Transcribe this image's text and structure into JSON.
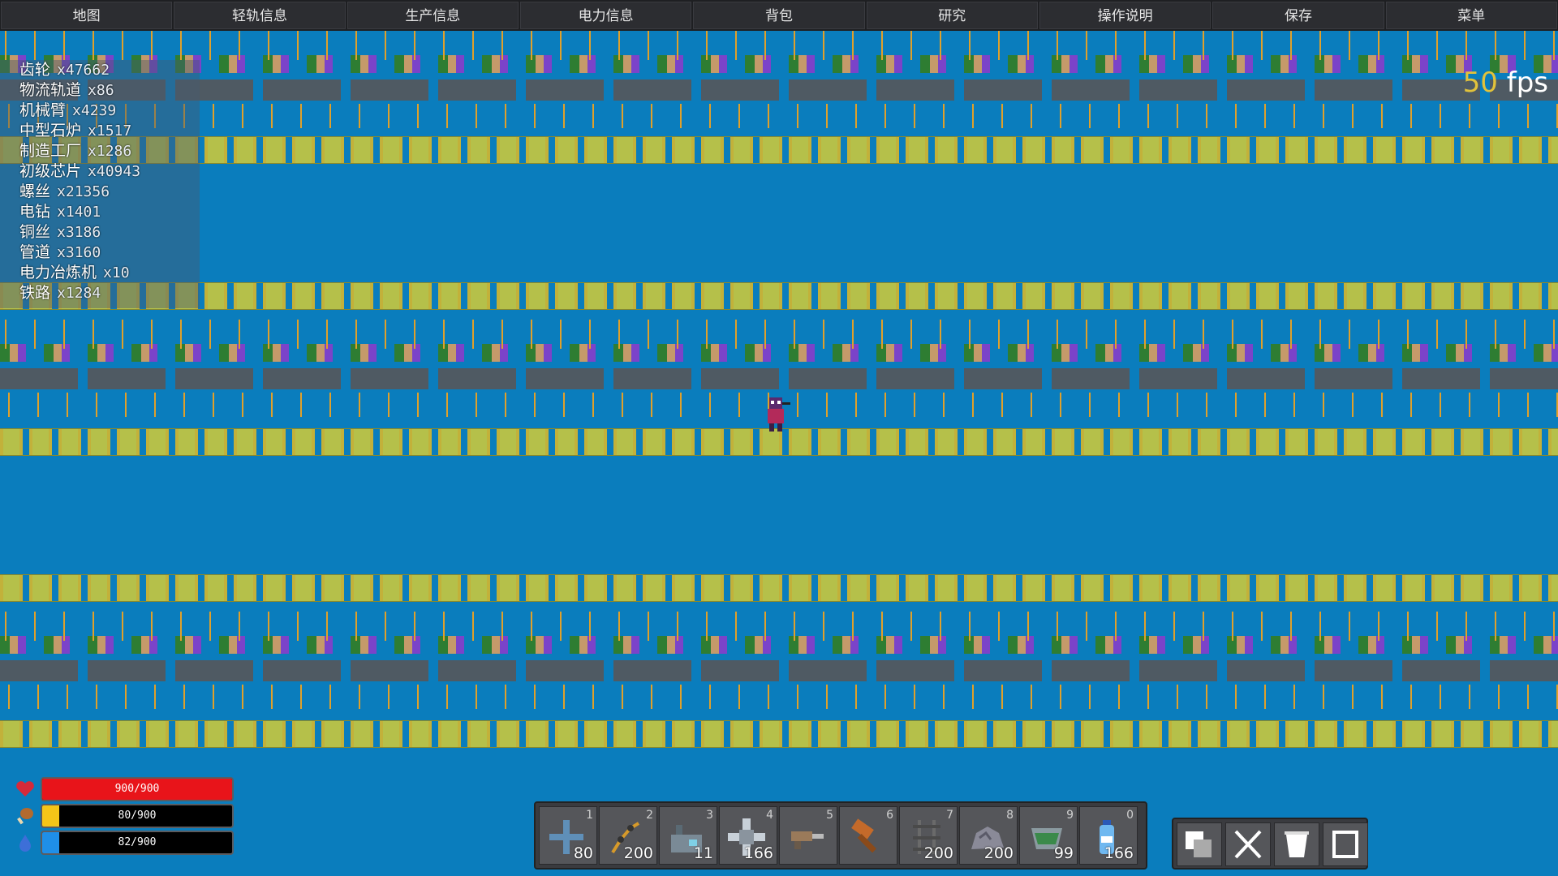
{
  "menu": {
    "items": [
      "地图",
      "轻轨信息",
      "生产信息",
      "电力信息",
      "背包",
      "研究",
      "操作说明",
      "保存",
      "菜单"
    ]
  },
  "inventory": {
    "items": [
      {
        "name": "齿轮",
        "count": "x47662"
      },
      {
        "name": "物流轨道",
        "count": "x86"
      },
      {
        "name": "机械臂",
        "count": "x4239"
      },
      {
        "name": "中型石炉",
        "count": "x1517"
      },
      {
        "name": "制造工厂",
        "count": "x1286"
      },
      {
        "name": "初级芯片",
        "count": "x40943"
      },
      {
        "name": "螺丝",
        "count": "x21356"
      },
      {
        "name": "电钻",
        "count": "x1401"
      },
      {
        "name": "铜丝",
        "count": "x3186"
      },
      {
        "name": "管道",
        "count": "x3160"
      },
      {
        "name": "电力冶炼机",
        "count": "x10"
      },
      {
        "name": "铁路",
        "count": "x1284"
      }
    ]
  },
  "fps": {
    "value": "50",
    "unit": "fps"
  },
  "stats": {
    "health": {
      "text": "900/900",
      "fraction": 1.0,
      "color": "#e8141a",
      "icon": "heart-icon"
    },
    "hunger": {
      "text": "80/900",
      "fraction": 0.089,
      "color": "#f5c518",
      "icon": "drumstick-icon"
    },
    "water": {
      "text": "82/900",
      "fraction": 0.091,
      "color": "#1f8fe8",
      "icon": "water-drop-icon"
    }
  },
  "hotbar": {
    "slots": [
      {
        "key": "1",
        "count": "80",
        "icon": "cross-tile-icon"
      },
      {
        "key": "2",
        "count": "200",
        "icon": "robot-arm-icon"
      },
      {
        "key": "3",
        "count": "11",
        "icon": "factory-machine-icon"
      },
      {
        "key": "4",
        "count": "166",
        "icon": "pipe-junction-icon"
      },
      {
        "key": "5",
        "count": "",
        "icon": "drill-icon"
      },
      {
        "key": "6",
        "count": "",
        "icon": "hammer-icon"
      },
      {
        "key": "7",
        "count": "200",
        "icon": "rail-track-icon"
      },
      {
        "key": "8",
        "count": "200",
        "icon": "ore-rock-icon"
      },
      {
        "key": "9",
        "count": "99",
        "icon": "bucket-icon"
      },
      {
        "key": "0",
        "count": "166",
        "icon": "water-bottle-icon"
      }
    ]
  },
  "tools": [
    "copy-icon",
    "delete-x-icon",
    "trash-bin-icon",
    "select-box-icon"
  ]
}
